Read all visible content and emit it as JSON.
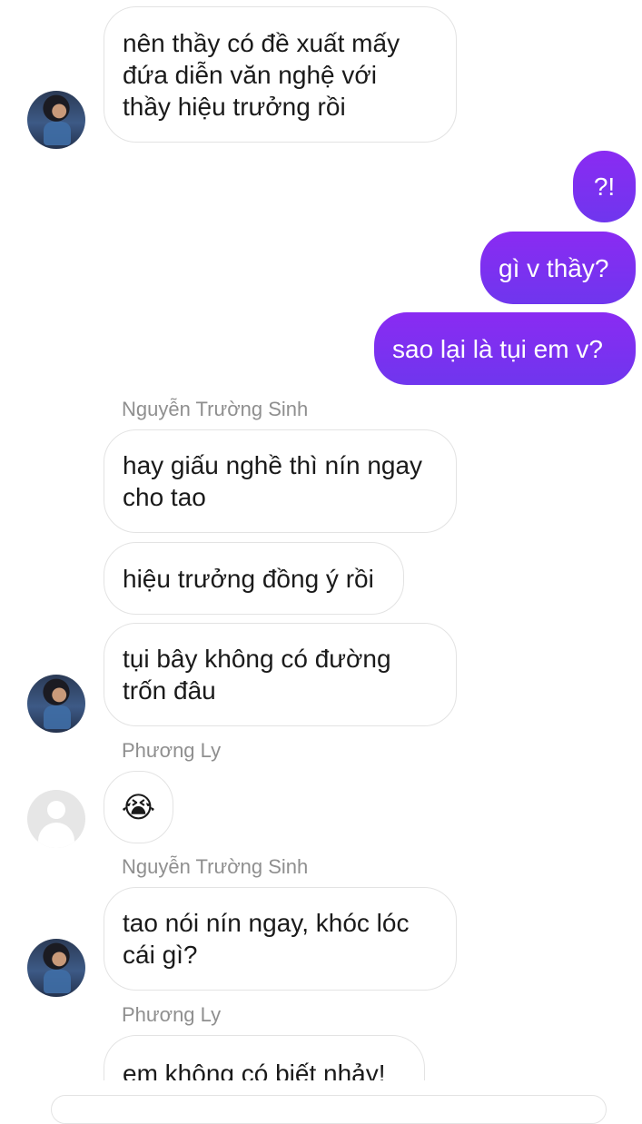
{
  "messages": {
    "m1": "nên thầy có đề xuất mấy\nđứa diễn văn nghệ với\nthầy hiệu trưởng rồi",
    "m2": "?!",
    "m3": "gì v thầy?",
    "m4": "sao lại là tụi em v?",
    "m5": "hay giấu nghề thì nín ngay\ncho tao",
    "m6": "hiệu trưởng đồng ý rồi",
    "m7": "tụi bây không có đường\ntrốn đâu",
    "m8": "😭",
    "m9": "tao nói nín ngay, khóc lóc\ncái gì?",
    "m10": "em không có biết nhảy!"
  },
  "senders": {
    "s1": "Nguyễn Trường Sinh",
    "s2": "Phương Ly",
    "s3": "Nguyễn Trường Sinh",
    "s4": "Phương Ly"
  },
  "colors": {
    "outgoing_bubble": "#7b2ff0",
    "incoming_border": "#e3e3e3",
    "sender_name": "#8f8f8f"
  }
}
